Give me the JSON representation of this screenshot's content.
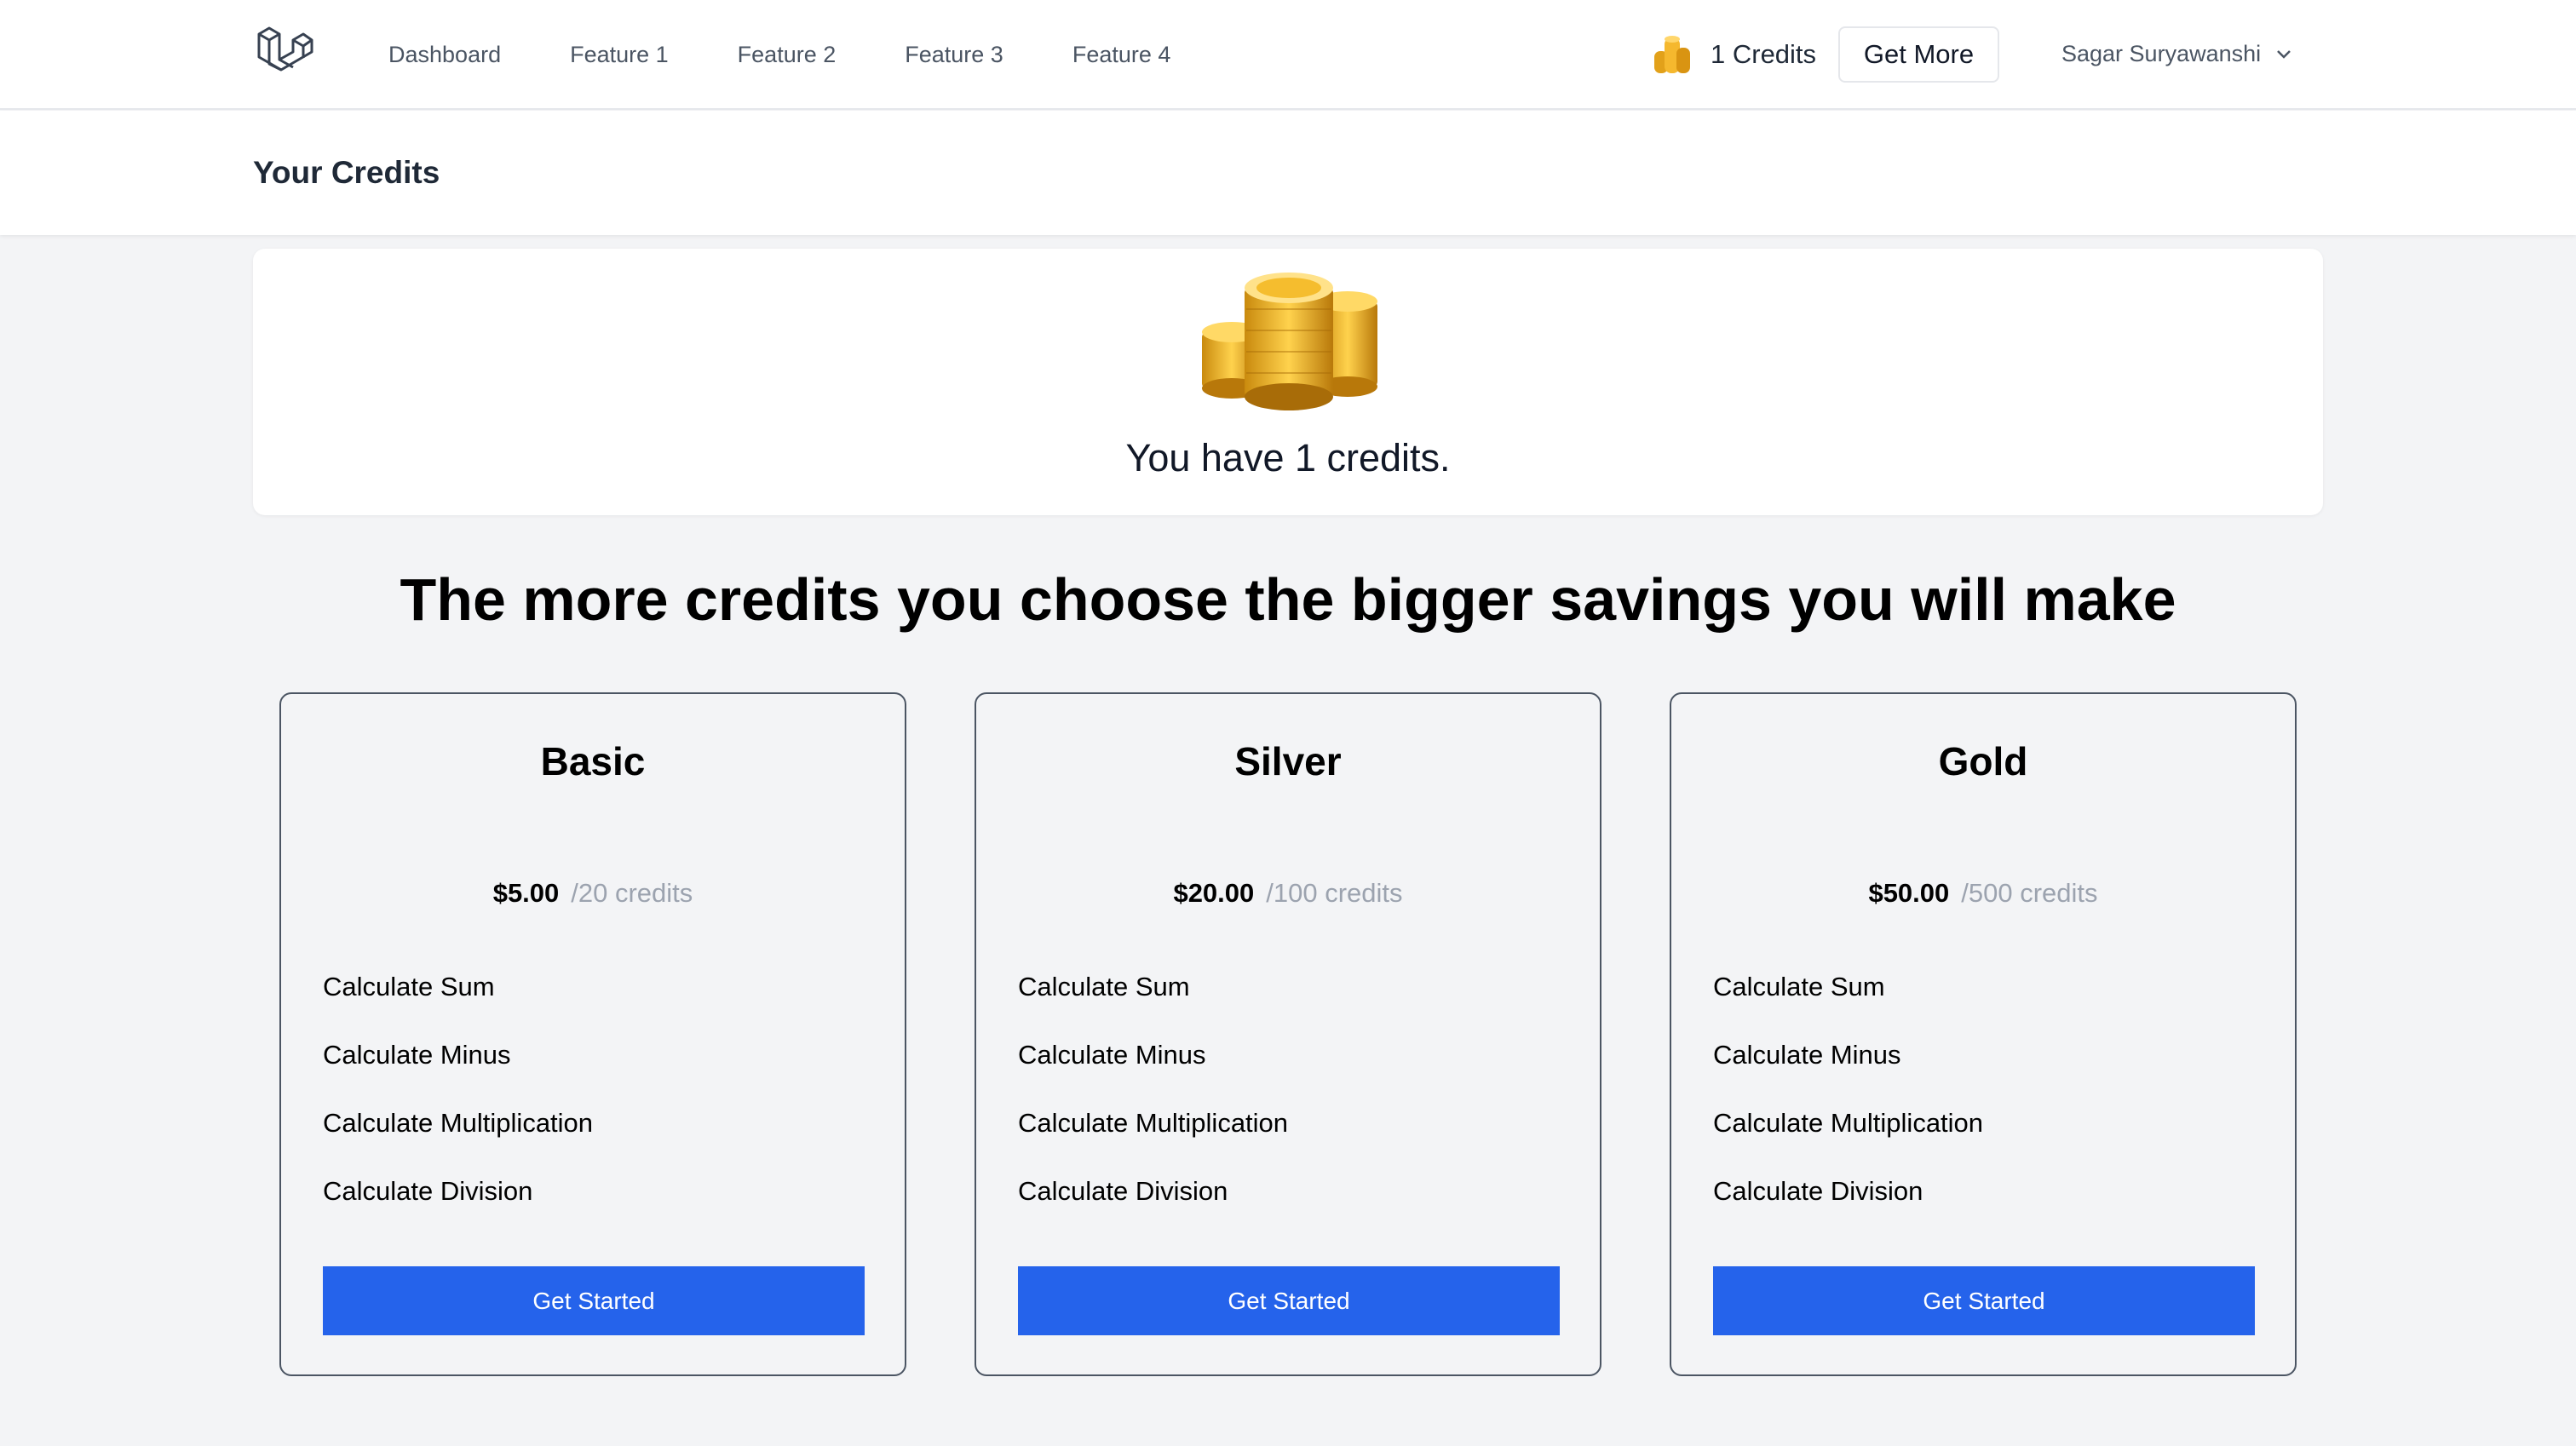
{
  "nav": {
    "links": [
      "Dashboard",
      "Feature 1",
      "Feature 2",
      "Feature 3",
      "Feature 4"
    ],
    "credits_label": "1 Credits",
    "get_more_label": "Get More",
    "user_name": "Sagar Suryawanshi"
  },
  "header": {
    "title": "Your Credits"
  },
  "credits_panel": {
    "message": "You have 1 credits."
  },
  "pricing": {
    "heading": "The more credits you choose the bigger savings you will make",
    "plans": [
      {
        "name": "Basic",
        "price": "$5.00",
        "credits": "/20 credits",
        "features": [
          "Calculate Sum",
          "Calculate Minus",
          "Calculate Multiplication",
          "Calculate Division"
        ],
        "cta": "Get Started"
      },
      {
        "name": "Silver",
        "price": "$20.00",
        "credits": "/100 credits",
        "features": [
          "Calculate Sum",
          "Calculate Minus",
          "Calculate Multiplication",
          "Calculate Division"
        ],
        "cta": "Get Started"
      },
      {
        "name": "Gold",
        "price": "$50.00",
        "credits": "/500 credits",
        "features": [
          "Calculate Sum",
          "Calculate Minus",
          "Calculate Multiplication",
          "Calculate Division"
        ],
        "cta": "Get Started"
      }
    ]
  },
  "colors": {
    "accent": "#2563eb",
    "page_bg": "#f3f4f6",
    "coin_gold": "#e2a11a"
  },
  "icons": [
    "laravel-logo-icon",
    "coin-stack-icon",
    "chevron-down-icon",
    "gold-coins-icon"
  ]
}
